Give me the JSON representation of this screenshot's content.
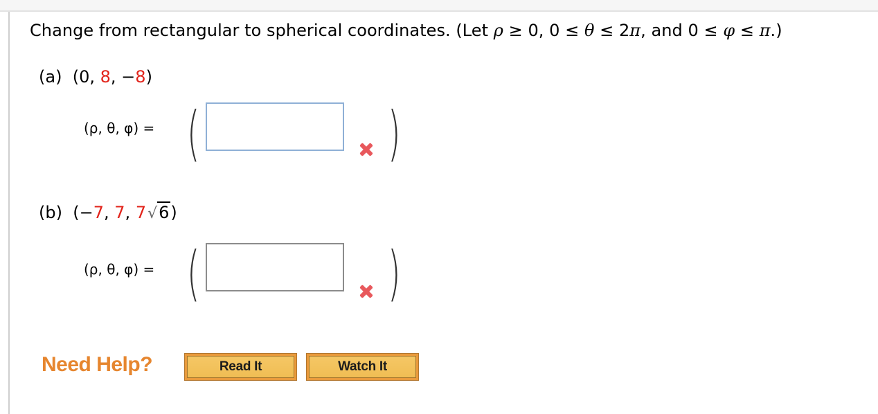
{
  "prompt": {
    "text": "Change from rectangular to spherical coordinates. (Let ",
    "rho": "ρ",
    "c1": " ≥ 0, 0 ≤ ",
    "theta": "θ",
    "c2": " ≤ 2",
    "pi1": "π",
    "c3": ", and 0 ≤ ",
    "phi": "φ",
    "c4": " ≤ ",
    "pi2": "π",
    "c5": ".)"
  },
  "parts": [
    {
      "label": "(a)",
      "point": {
        "open": "(",
        "x": "0",
        "sep1": ", ",
        "y": "8",
        "sep2": ", −",
        "z": "8",
        "close": ")"
      },
      "coord_label": "(ρ, θ, φ) =",
      "answer_value": "",
      "status_icon": "incorrect-x-icon",
      "status_color": "#e8585c"
    },
    {
      "label": "(b)",
      "point": {
        "open": "(−",
        "x": "7",
        "sep1": ", ",
        "y": "7",
        "sep2": ", ",
        "z": "7",
        "radical": "√",
        "radicand": "6",
        "close": ")"
      },
      "coord_label": "(ρ, θ, φ) =",
      "answer_value": "",
      "status_icon": "incorrect-x-icon",
      "status_color": "#e8585c"
    }
  ],
  "help": {
    "label": "Need Help?",
    "buttons": [
      "Read It",
      "Watch It"
    ]
  },
  "colors": {
    "highlight_red": "#e2231a",
    "help_orange": "#e6862f",
    "button_fill": "#f0bd54"
  }
}
